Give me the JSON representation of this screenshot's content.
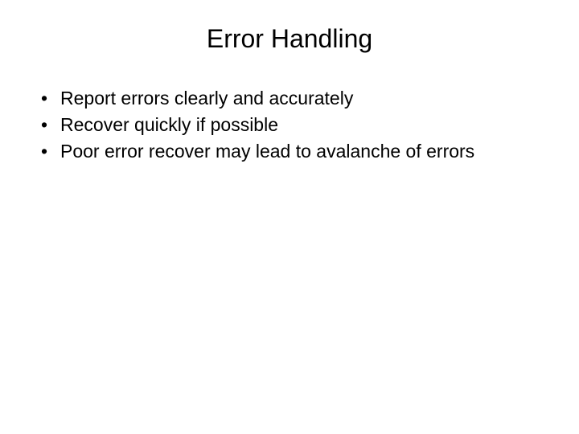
{
  "slide": {
    "title": "Error Handling",
    "bullets": [
      "Report errors clearly and accurately",
      "Recover quickly if possible",
      "Poor error recover may lead to avalanche of errors"
    ]
  }
}
